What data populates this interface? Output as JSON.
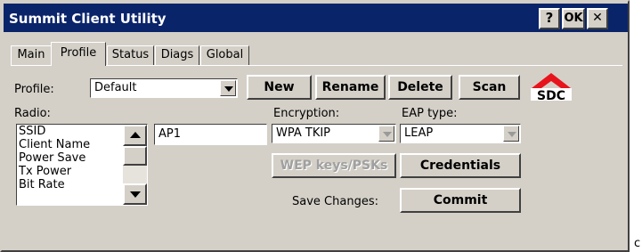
{
  "window": {
    "title": "Summit Client Utility",
    "help_label": "?",
    "ok_label": "OK",
    "close_label": "✕"
  },
  "tabs": [
    {
      "label": "Main",
      "active": false
    },
    {
      "label": "Profile",
      "active": true
    },
    {
      "label": "Status",
      "active": false
    },
    {
      "label": "Diags",
      "active": false
    },
    {
      "label": "Global",
      "active": false
    }
  ],
  "profile": {
    "label": "Profile:",
    "value": "Default"
  },
  "toolbar": {
    "new_label": "New",
    "rename_label": "Rename",
    "delete_label": "Delete",
    "scan_label": "Scan"
  },
  "logo": {
    "text": "SDC",
    "color": "#e8141c"
  },
  "radio": {
    "label": "Radio:",
    "items": [
      "SSID",
      "Client Name",
      "Power Save",
      "Tx Power",
      "Bit Rate"
    ],
    "value": "AP1"
  },
  "encryption": {
    "label": "Encryption:",
    "value": "WPA TKIP"
  },
  "eap": {
    "label": "EAP type:",
    "value": "LEAP"
  },
  "buttons": {
    "wep_label": "WEP keys/PSKs",
    "credentials_label": "Credentials",
    "commit_label": "Commit"
  },
  "save_changes_label": "Save Changes:",
  "stray_text": "c",
  "colors": {
    "titlebar": "#0a246a",
    "face": "#d4d0c8"
  }
}
